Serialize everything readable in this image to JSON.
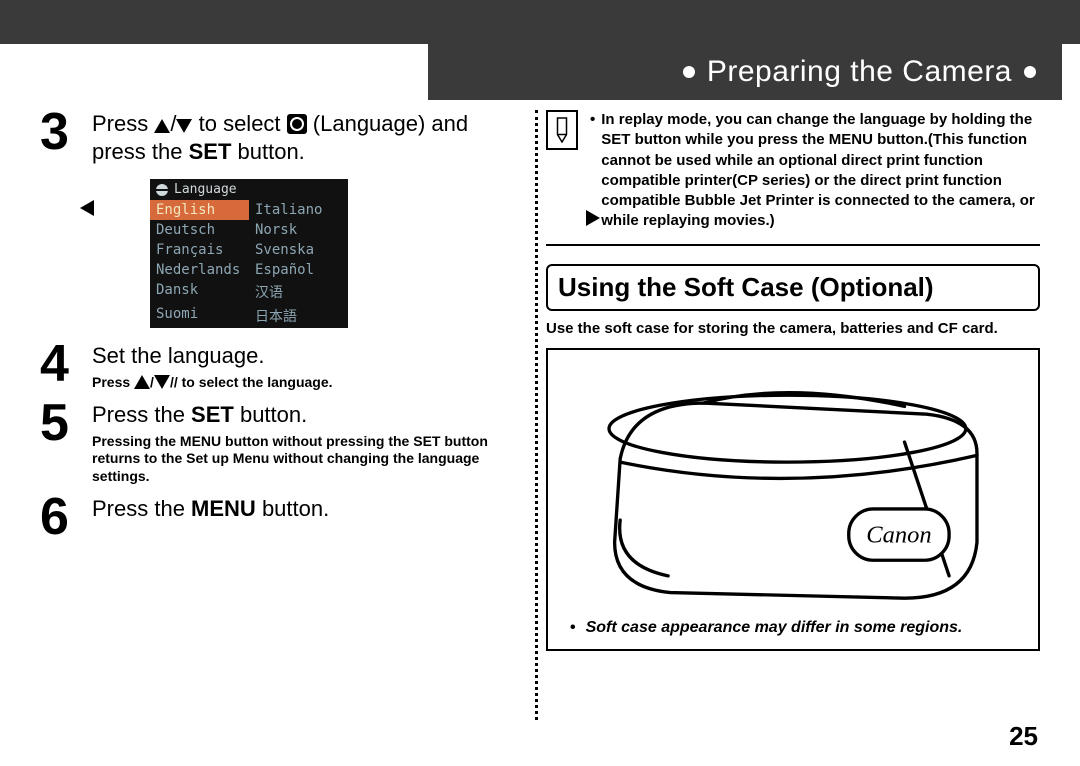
{
  "section_title": "Preparing the Camera",
  "page_number": "25",
  "steps": {
    "s3": {
      "num": "3",
      "pre": "Press ",
      "mid": " to select ",
      "post": " (Language) and press the ",
      "set": "SET",
      "end": " button."
    },
    "s4": {
      "num": "4",
      "main": "Set the language.",
      "sub_pre": "Press ",
      "sub_post": " to select the language."
    },
    "s5": {
      "num": "5",
      "pre": "Press the ",
      "set": "SET",
      "post": " button.",
      "sub": "Pressing the MENU button without pressing the SET button returns to the Set up Menu without changing the language settings."
    },
    "s6": {
      "num": "6",
      "pre": "Press the ",
      "menu": "MENU",
      "post": " button."
    }
  },
  "lang_menu": {
    "title": "Language",
    "cells": [
      "English",
      "Italiano",
      "Deutsch",
      "Norsk",
      "Français",
      "Svenska",
      "Nederlands",
      "Español",
      "Dansk",
      "汉语",
      "Suomi",
      "日本語"
    ]
  },
  "note": {
    "text": "In replay mode, you can change the language by holding the SET button while you press the MENU button.(This function cannot be used while an optional direct print function compatible printer(CP series) or the direct print function compatible Bubble Jet Printer is connected to the camera, or while replaying movies.)"
  },
  "softcase": {
    "heading": "Using the Soft Case (Optional)",
    "sub": "Use the soft case for storing the camera, batteries and CF card.",
    "brand": "Canon",
    "footnote": "Soft case appearance may differ in some regions."
  }
}
